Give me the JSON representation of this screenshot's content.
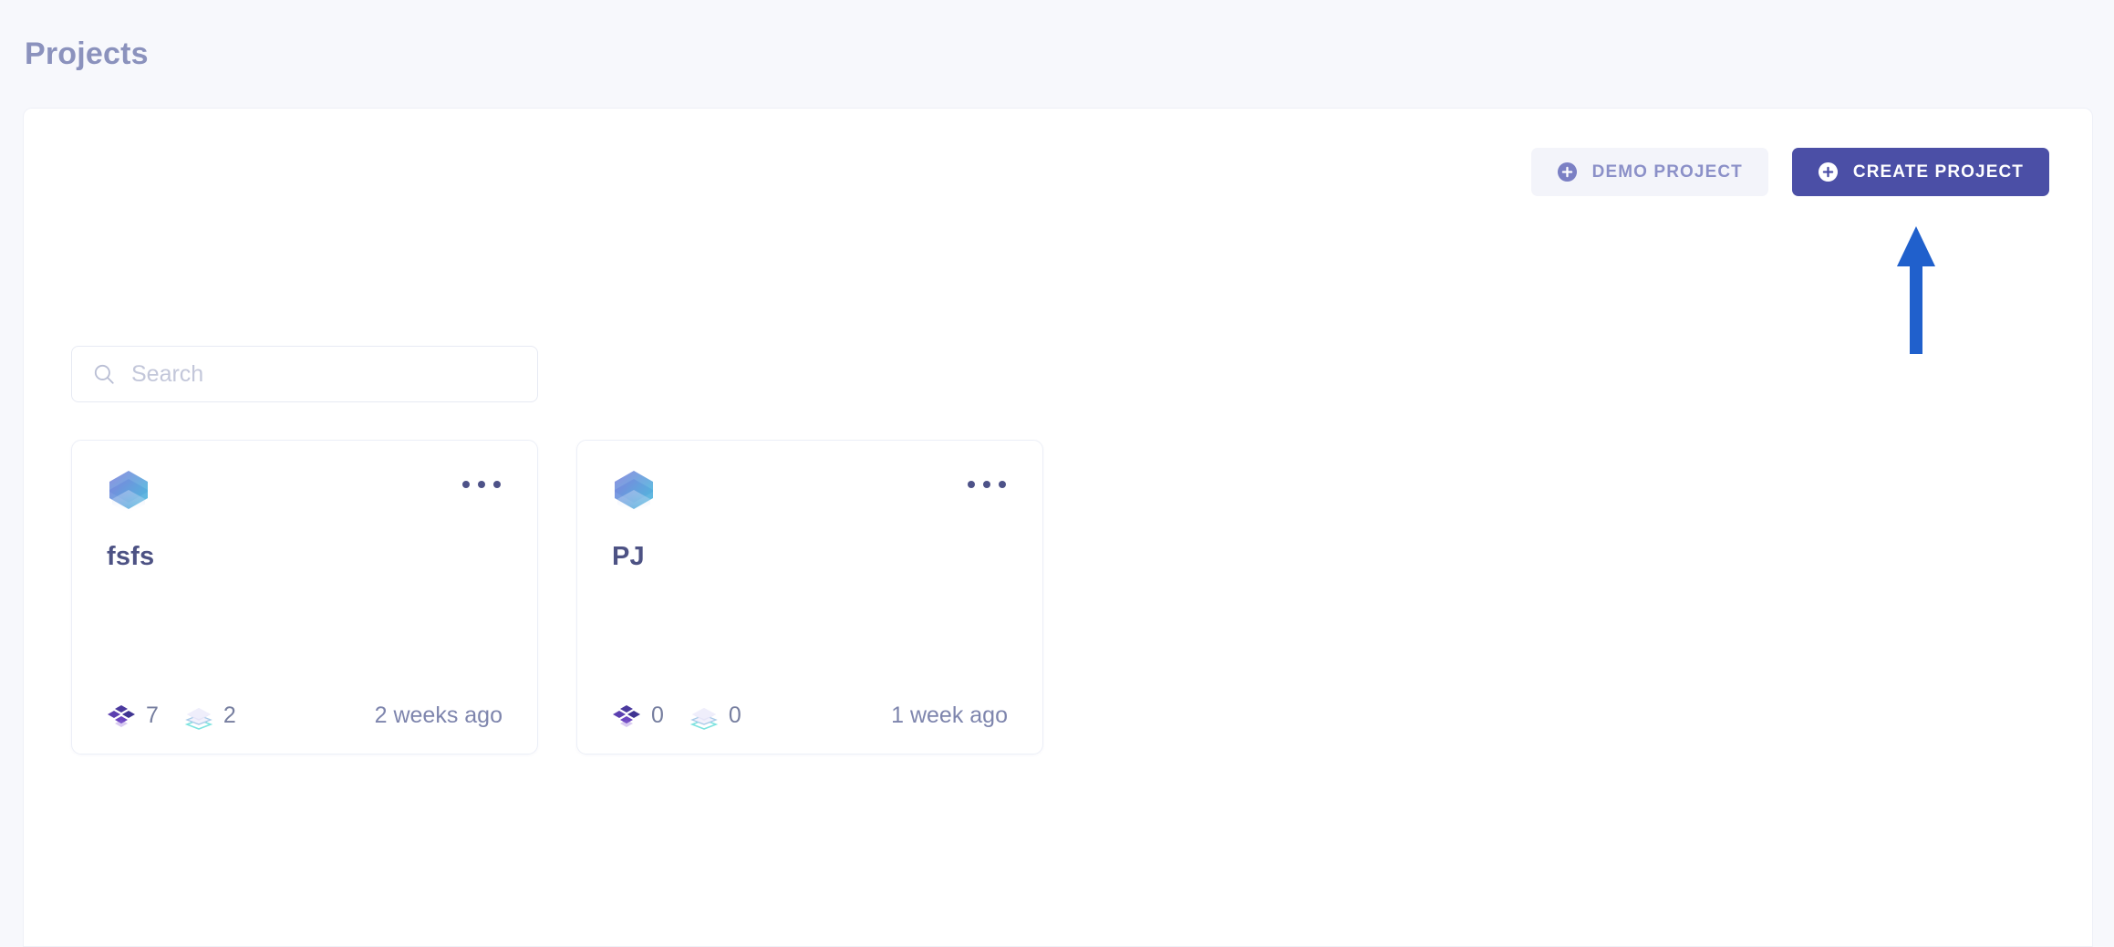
{
  "page": {
    "title": "Projects",
    "background_color": "#f7f8fc",
    "panel_color": "#ffffff"
  },
  "toolbar": {
    "demo_button": {
      "label": "DEMO PROJECT",
      "icon": "plus-circle-icon",
      "background_color": "#f3f4fa",
      "text_color": "#8b90c8"
    },
    "create_button": {
      "label": "CREATE PROJECT",
      "icon": "plus-circle-icon",
      "background_color": "#4b4fa6",
      "text_color": "#ffffff"
    }
  },
  "search": {
    "icon": "search-icon",
    "placeholder": "Search",
    "value": ""
  },
  "projects": [
    {
      "name": "fsfs",
      "logo_icon": "hexagon-cube-icon",
      "menu_icon": "more-horizontal-icon",
      "members_icon": "cluster-icon",
      "members_count": "7",
      "layers_icon": "layers-icon",
      "layers_count": "2",
      "updated": "2 weeks ago"
    },
    {
      "name": "PJ",
      "logo_icon": "hexagon-cube-icon",
      "menu_icon": "more-horizontal-icon",
      "members_icon": "cluster-icon",
      "members_count": "0",
      "layers_icon": "layers-icon",
      "layers_count": "0",
      "updated": "1 week ago"
    }
  ],
  "annotation": {
    "arrow": "up-arrow-annotation",
    "color": "#2060cc",
    "points_to": "CREATE PROJECT"
  }
}
